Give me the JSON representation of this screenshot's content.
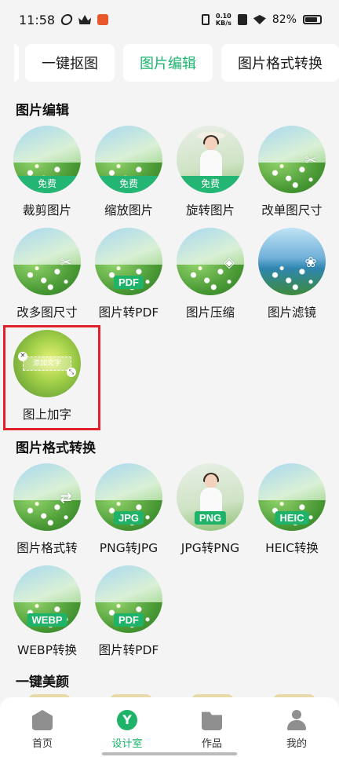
{
  "status_bar": {
    "time": "11:58",
    "net_speed_value": "0.10",
    "net_speed_unit": "KB/s",
    "battery": "82%"
  },
  "tabs": [
    "一键抠图",
    "图片编辑",
    "图片格式转换"
  ],
  "sections": {
    "edit": {
      "title": "图片编辑",
      "items": [
        {
          "label": "裁剪图片",
          "badge": "免费"
        },
        {
          "label": "缩放图片",
          "badge": "免费"
        },
        {
          "label": "旋转图片",
          "badge": "免费"
        },
        {
          "label": "改单图尺寸"
        },
        {
          "label": "改多图尺寸"
        },
        {
          "label": "图片转PDF",
          "badge": "PDF"
        },
        {
          "label": "图片压缩"
        },
        {
          "label": "图片滤镜"
        },
        {
          "label": "图上加字",
          "overlay_text": "添加文字"
        }
      ]
    },
    "format": {
      "title": "图片格式转换",
      "items": [
        {
          "label": "图片格式转"
        },
        {
          "label": "PNG转JPG",
          "badge": "JPG"
        },
        {
          "label": "JPG转PNG",
          "badge": "PNG"
        },
        {
          "label": "HEIC转换",
          "badge": "HEIC"
        },
        {
          "label": "WEBP转换",
          "badge": "WEBP"
        },
        {
          "label": "图片转PDF",
          "badge": "PDF"
        }
      ]
    },
    "beauty": {
      "title": "一键美颜"
    }
  },
  "bottom_nav": [
    {
      "label": "首页",
      "icon": "home-icon"
    },
    {
      "label": "设计室",
      "icon": "design-room-icon"
    },
    {
      "label": "作品",
      "icon": "folder-icon"
    },
    {
      "label": "我的",
      "icon": "profile-icon"
    }
  ],
  "colors": {
    "accent": "#19b46d",
    "highlight": "#e0202a"
  }
}
